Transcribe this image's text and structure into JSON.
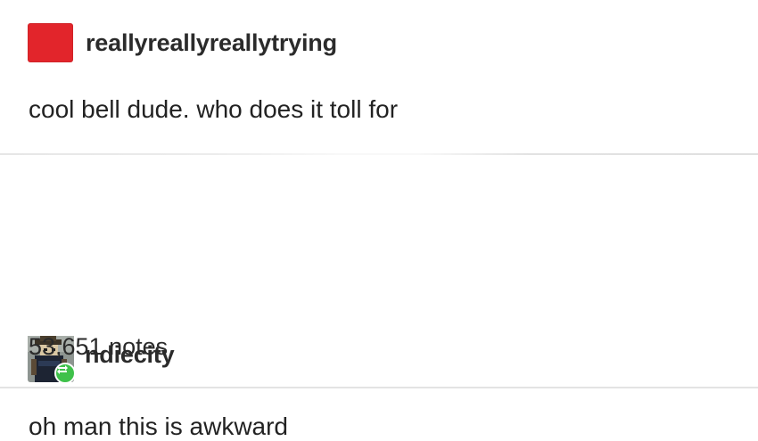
{
  "posts": [
    {
      "username": "reallyreallyreallytrying",
      "avatar_icon": "red-square-avatar",
      "avatar_color": "#e2252b",
      "text": "cool bell dude. who does it toll for"
    },
    {
      "username": "ndiecity",
      "avatar_icon": "pixel-character-avatar",
      "badge_icon": "reblog-icon",
      "badge_color": "#3fc14a",
      "text": "oh man this is awkward"
    }
  ],
  "footer": {
    "notes": "53,651 notes"
  }
}
